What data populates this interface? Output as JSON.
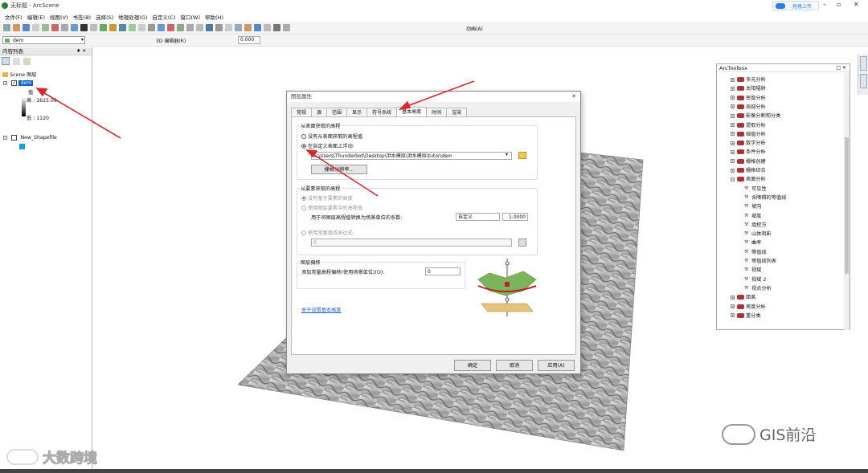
{
  "app": {
    "title": "无标题 - ArcScene",
    "upload_label": "拖拽上传"
  },
  "menu": [
    "文件(F)",
    "编辑(E)",
    "视图(V)",
    "书签(B)",
    "选择(S)",
    "地理处理(G)",
    "自定义(C)",
    "窗口(W)",
    "帮助(H)"
  ],
  "toolbar": {
    "layer_select": "dem",
    "editor_label": "3D 编辑器(R)",
    "value_field": "0.000",
    "animation_label": "动画(A)"
  },
  "toc": {
    "title": "内容列表",
    "scene_label": "Scene 图层",
    "layer1": "dem",
    "value_label": "值",
    "high": "高 : 1625.08",
    "low": "低 : 1120",
    "layer2": "New_Shapefile"
  },
  "dialog": {
    "title": "图层属性",
    "tabs": [
      "常规",
      "源",
      "范围",
      "显示",
      "符号系统",
      "基本高度",
      "时间",
      "渲染"
    ],
    "active_tab": "基本高度",
    "group1_title": "从表面获取的高程",
    "radio_no_surface": "没有从表面获取的高程值",
    "radio_custom_surface": "在自定义表面上浮动:",
    "surface_path": "C:\\Users\\Thunderbot\\Desktop\\洪水模拟\\洪水模拟\\tutor\\dem",
    "raster_res_button": "栅格分辨率...",
    "group2_title": "从要素获取的高程",
    "radio_no_feature": "没有基于要素的高度",
    "radio_use_feature": "使用图层要素中的高程值",
    "factor_label": "用于将图层高程值转换为场景单位的系数:",
    "factor_select": "自定义",
    "factor_value": "1.0000",
    "radio_expression": "使用常量值或表达式:",
    "expression_value": "0",
    "group3_title": "图层偏移",
    "offset_label": "添加常量高程偏移(使用场景单位)(O):",
    "offset_value": "0",
    "help_link": "关于设置基本高度",
    "ok": "确定",
    "cancel": "取消",
    "apply": "应用(A)"
  },
  "toolbox": {
    "title": "ArcToolbox",
    "items": [
      "多元分析",
      "太阳辐射",
      "密度分析",
      "局部分析",
      "影像分割和分类",
      "提取分析",
      "插值分析",
      "数学分析",
      "条件分析",
      "栅格创建",
      "栅格综合",
      "表面分析"
    ],
    "subitems": [
      "可见性",
      "含障碍的等值线",
      "坡向",
      "坡度",
      "填挖方",
      "山体阴影",
      "曲率",
      "等值线",
      "等值线列表",
      "视域",
      "视域 2",
      "视点分析"
    ],
    "after": [
      "距离",
      "密度分析",
      "重分类"
    ]
  },
  "watermarks": {
    "left": "大数跨境",
    "right": "GIS前沿"
  },
  "colors": {
    "accent": "#1e73be",
    "arrow": "#d7282d"
  }
}
